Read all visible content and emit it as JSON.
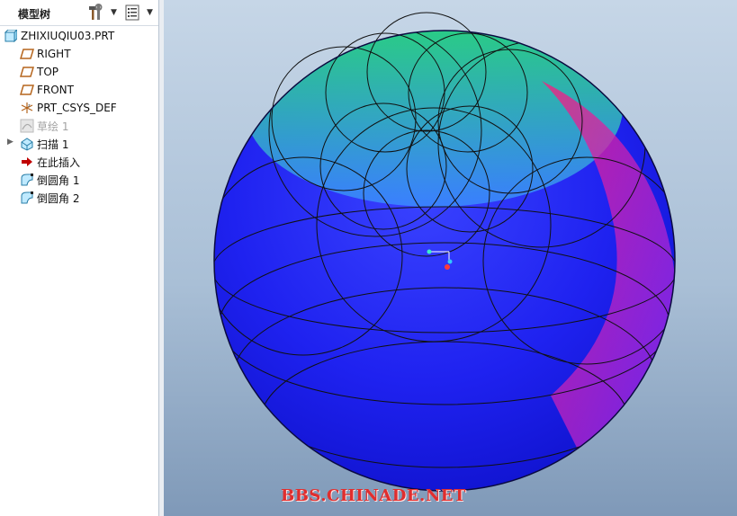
{
  "model_tree": {
    "title": "模型树",
    "part_name": "ZHIXIUQIU03.PRT",
    "items": [
      {
        "label": "RIGHT",
        "icon": "datum-plane-icon"
      },
      {
        "label": "TOP",
        "icon": "datum-plane-icon"
      },
      {
        "label": "FRONT",
        "icon": "datum-plane-icon"
      },
      {
        "label": "PRT_CSYS_DEF",
        "icon": "csys-icon"
      },
      {
        "label": "草绘 1",
        "icon": "sketch-icon",
        "state": "suppressed-grey"
      },
      {
        "label": "扫描 1",
        "icon": "sweep-icon",
        "expandable": true
      },
      {
        "label": "在此插入",
        "icon": "insert-here-arrow-icon"
      },
      {
        "label": "倒圆角 1",
        "icon": "round-icon"
      },
      {
        "label": "倒圆角 2",
        "icon": "round-icon"
      }
    ]
  },
  "viewport": {
    "watermark": "BBS.CHINADE.NET",
    "background_top": "#c6d6e7",
    "background_bottom": "#7f99b8"
  },
  "colors": {
    "watermark": "#e02e2e",
    "datum_plane": "#b5651d",
    "insert_arrow": "#c00000"
  }
}
